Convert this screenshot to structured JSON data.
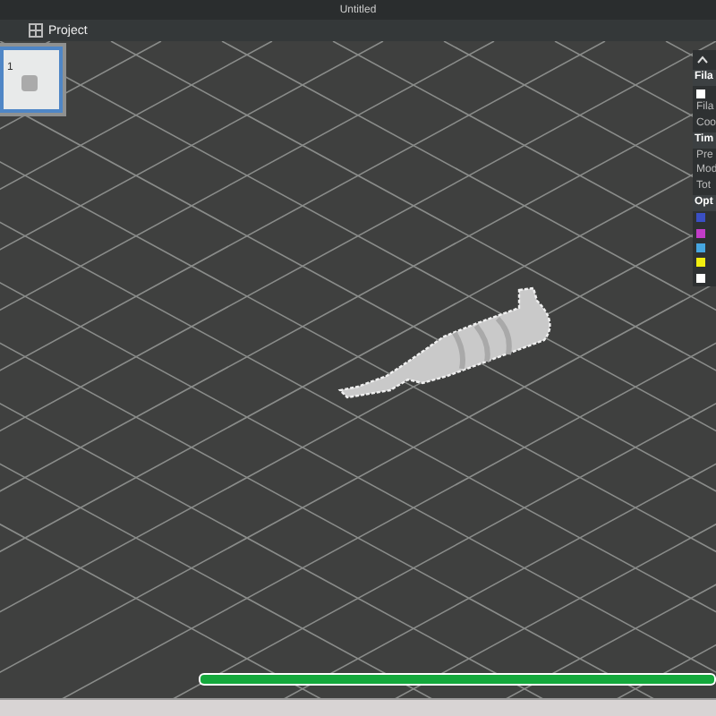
{
  "window": {
    "title": "Untitled"
  },
  "tabs": [
    {
      "label": "Project",
      "selected": true
    }
  ],
  "plates": [
    {
      "label": "1",
      "selected": true
    }
  ],
  "legend": {
    "sections": [
      {
        "title": "Fila",
        "rows": [
          {
            "kind": "checkbox",
            "checked": true
          },
          {
            "kind": "text",
            "text": "Fila"
          },
          {
            "kind": "text",
            "text": "Coo"
          }
        ]
      },
      {
        "title": "Tim",
        "rows": [
          {
            "kind": "text",
            "text": "Pre"
          },
          {
            "kind": "text",
            "text": "Mod"
          },
          {
            "kind": "text",
            "text": "Tot"
          }
        ]
      },
      {
        "title": "Opt",
        "rows": [
          {
            "kind": "swatch",
            "color": "#3a4fc4"
          },
          {
            "kind": "swatch",
            "color": "#c23cc8"
          },
          {
            "kind": "swatch",
            "color": "#46a6e0"
          },
          {
            "kind": "swatch",
            "color": "#f2ee10"
          },
          {
            "kind": "swatch",
            "color": "#ffffff"
          }
        ]
      }
    ]
  },
  "progress": {
    "level": 1
  }
}
